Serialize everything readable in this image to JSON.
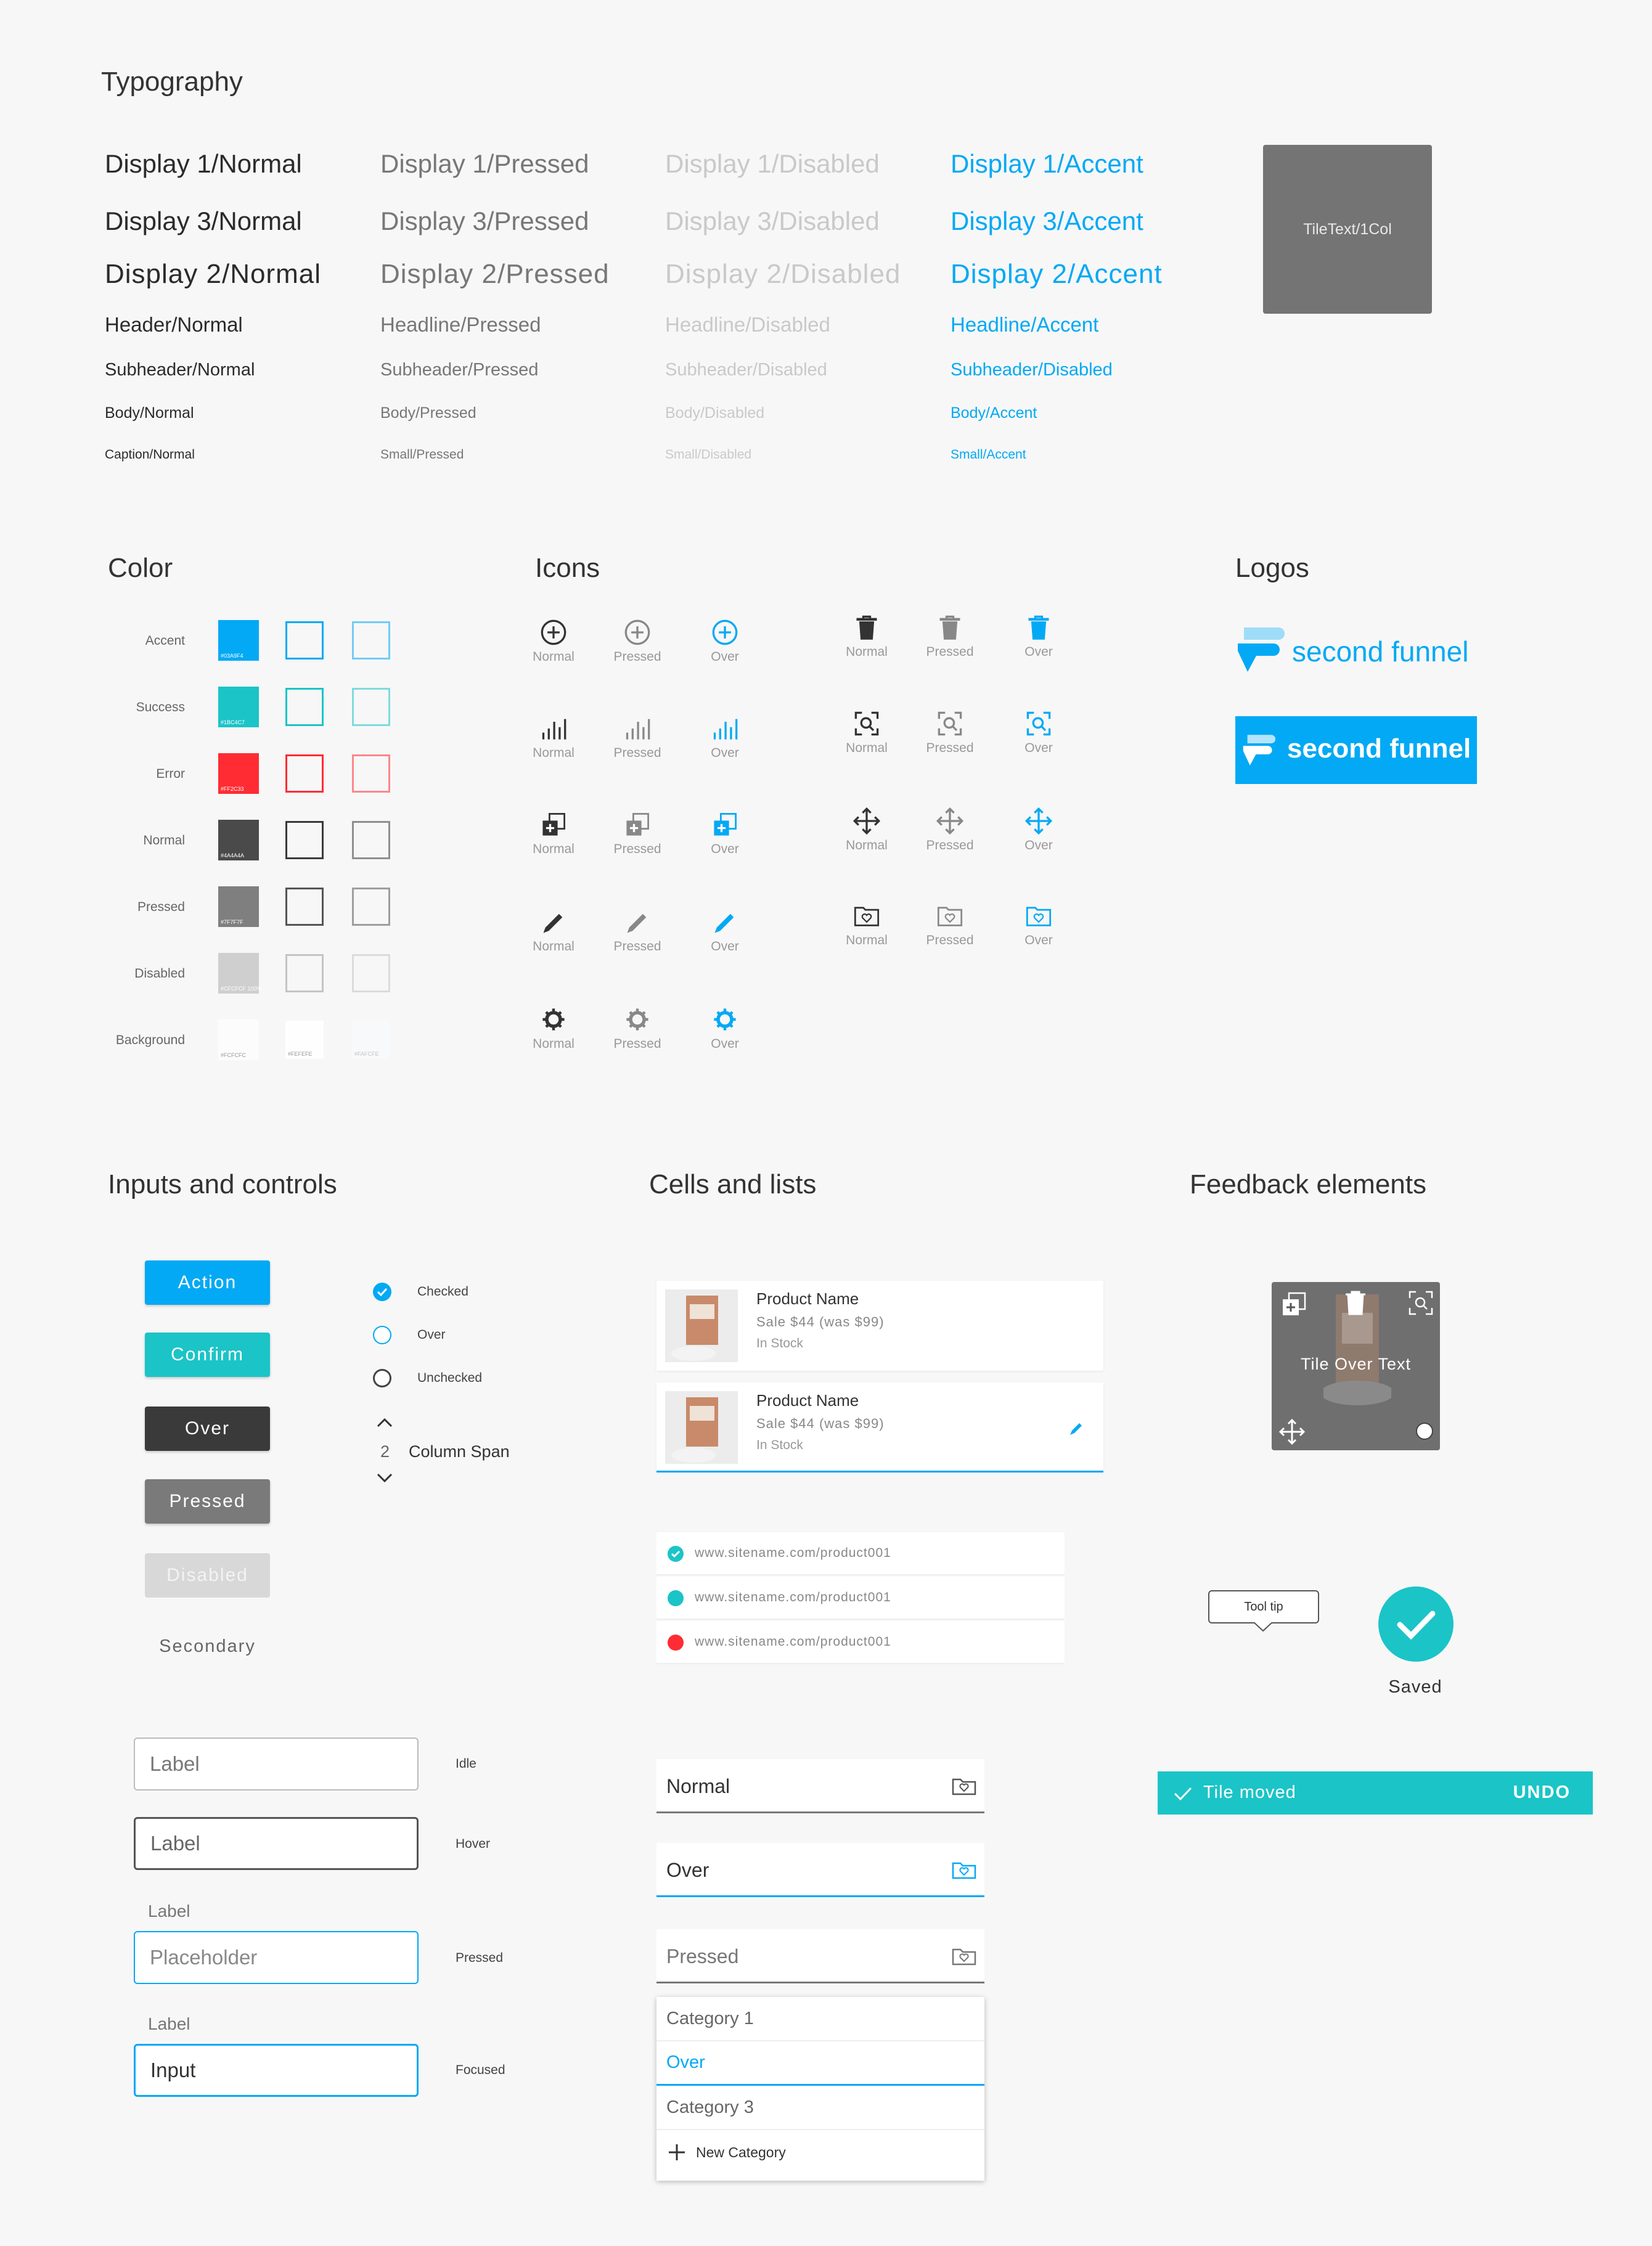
{
  "sections": {
    "typography": "Typography",
    "color": "Color",
    "icons": "Icons",
    "logos": "Logos",
    "inputs": "Inputs and controls",
    "cells": "Cells and lists",
    "feedback": "Feedback elements"
  },
  "typography": {
    "normal": [
      "Display 1/Normal",
      "Display 3/Normal",
      "Display 2/Normal",
      "Header/Normal",
      "Subheader/Normal",
      "Body/Normal",
      "Caption/Normal"
    ],
    "pressed": [
      "Display 1/Pressed",
      "Display 3/Pressed",
      "Display 2/Pressed",
      "Headline/Pressed",
      "Subheader/Pressed",
      "Body/Pressed",
      "Small/Pressed"
    ],
    "disabled": [
      "Display 1/Disabled",
      "Display 3/Disabled",
      "Display 2/Disabled",
      "Headline/Disabled",
      "Subheader/Disabled",
      "Body/Disabled",
      "Small/Disabled"
    ],
    "accent": [
      "Display 1/Accent",
      "Display 3/Accent",
      "Display 2/Accent",
      "Headline/Accent",
      "Subheader/Disabled",
      "Body/Accent",
      "Small/Accent"
    ],
    "tile_text": "TileText/1Col"
  },
  "colors": [
    {
      "label": "Accent",
      "hex": "#03A9F4",
      "fill": "#03a9f4",
      "stroke": "#03a9f4"
    },
    {
      "label": "Success",
      "hex": "#1BC4C7",
      "fill": "#1bc4c7",
      "stroke": "#1bc4c7"
    },
    {
      "label": "Error",
      "hex": "#FF2C33",
      "fill": "#ff2c33",
      "stroke": "#ff2c33"
    },
    {
      "label": "Normal",
      "hex": "#4A4A4A",
      "fill": "#4a4a4a",
      "stroke": "#3a3a3a"
    },
    {
      "label": "Pressed",
      "hex": "#7F7F7F",
      "fill": "#7f7f7f",
      "stroke": "#555555"
    },
    {
      "label": "Disabled",
      "hex": "#CFCFCF 100%",
      "fill": "#cfcfcf",
      "stroke": "#c4c4c4"
    },
    {
      "label": "Background",
      "hex": "#FCFCFC",
      "fill": "#fcfcfc",
      "stroke": "#fefefe",
      "hex2": "#FEFEFE",
      "hex3": "#FAFCFE"
    }
  ],
  "icon_states": {
    "normal": "Normal",
    "pressed": "Pressed",
    "over": "Over"
  },
  "logos": {
    "brand": "second funnel",
    "brand_color": "#03a9f4"
  },
  "buttons": {
    "action": "Action",
    "confirm": "Confirm",
    "over": "Over",
    "pressed": "Pressed",
    "disabled": "Disabled",
    "secondary": "Secondary"
  },
  "radios": {
    "checked": "Checked",
    "over": "Over",
    "unchecked": "Unchecked"
  },
  "stepper": {
    "value": "2",
    "label": "Column Span"
  },
  "fields": {
    "idle": {
      "value": "Label",
      "state": "Idle"
    },
    "hover": {
      "value": "Label",
      "state": "Hover"
    },
    "pressed": {
      "label": "Label",
      "placeholder": "Placeholder",
      "state": "Pressed"
    },
    "focused": {
      "label": "Label",
      "value": "Input",
      "state": "Focused"
    }
  },
  "products": [
    {
      "name": "Product Name",
      "sale": "Sale $44 (was $99)",
      "stock": "In Stock"
    },
    {
      "name": "Product Name",
      "sale": "Sale $44 (was $99)",
      "stock": "In Stock"
    }
  ],
  "urls": [
    "www.sitename.com/product001",
    "www.sitename.com/product001",
    "www.sitename.com/product001"
  ],
  "dropdowns": {
    "normal": "Normal",
    "over": "Over",
    "pressed": "Pressed"
  },
  "menu": {
    "item1": "Category 1",
    "item2": "Over",
    "item3": "Category 3",
    "new": "New Category"
  },
  "feedback": {
    "tile_text": "Tile Over Text",
    "tooltip": "Tool tip",
    "saved": "Saved",
    "snackbar": "Tile moved",
    "undo": "UNDO"
  }
}
